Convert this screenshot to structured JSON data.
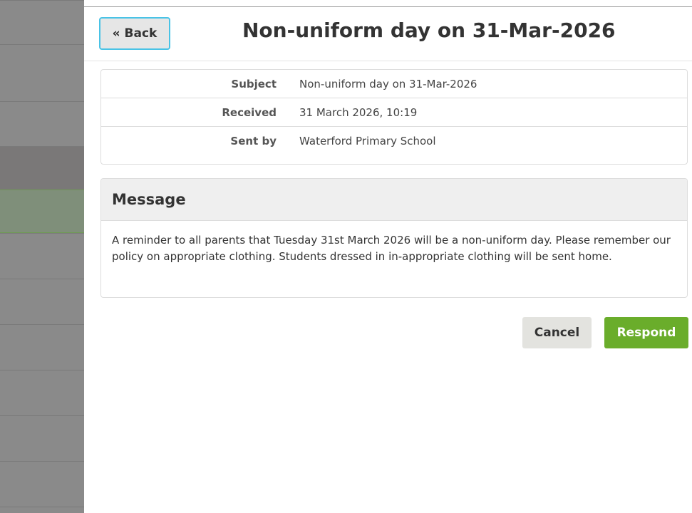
{
  "sidebar": {
    "rows": [
      {
        "color": "#8a8a8a"
      },
      {
        "color": "#8a8a8a"
      },
      {
        "color": "#8a8a8a"
      },
      {
        "color": "#7a7878"
      },
      {
        "color": "#7f8f7a"
      },
      {
        "color": "#8a8a8a"
      },
      {
        "color": "#8a8a8a"
      },
      {
        "color": "#8a8a8a"
      },
      {
        "color": "#8a8a8a"
      },
      {
        "color": "#8a8a8a"
      },
      {
        "color": "#8a8a8a"
      },
      {
        "color": "#8a8a8a"
      }
    ]
  },
  "header": {
    "back_label": "« Back",
    "title": "Non-uniform day on 31-Mar-2026"
  },
  "details": {
    "subject_label": "Subject",
    "subject_value": "Non-uniform day on 31-Mar-2026",
    "received_label": "Received",
    "received_value": "31 March 2026, 10:19",
    "sent_by_label": "Sent by",
    "sent_by_value": "Waterford Primary School"
  },
  "message": {
    "heading": "Message",
    "body": "A reminder to all parents that Tuesday 31st March 2026 will be a non-uniform day. Please remember our policy on appropriate clothing. Students dressed in in-appropriate clothing will be sent home."
  },
  "actions": {
    "cancel_label": "Cancel",
    "respond_label": "Respond"
  },
  "colors": {
    "accent_border": "#49c3e6",
    "respond_bg": "#6aad2b",
    "cancel_bg": "#e3e3df"
  }
}
